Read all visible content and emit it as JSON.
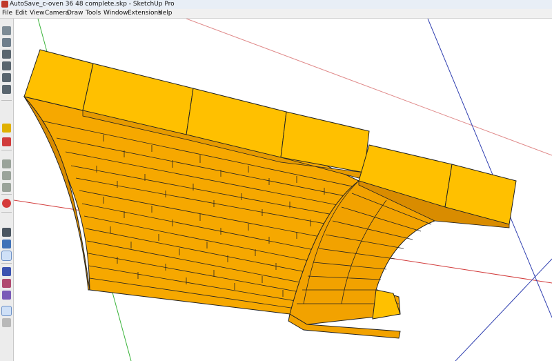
{
  "window": {
    "title": "AutoSave_c-oven 36 48 complete.skp - SketchUp Pro"
  },
  "menu": [
    "File",
    "Edit",
    "View",
    "Camera",
    "Draw",
    "Tools",
    "Window",
    "Extensions",
    "Help"
  ],
  "toolbar": {
    "icons": [
      "iso-view-icon",
      "top-view-icon",
      "front-view-icon",
      "right-view-icon",
      "back-view-icon",
      "left-view-icon",
      "tape-measure-icon",
      "paint-bucket-icon",
      "component-icon",
      "group-icon",
      "section-plane-icon",
      "orbit-icon",
      "pan-icon",
      "zoom-icon",
      "axes-icon",
      "style-icon",
      "shadow-icon",
      "layer-icon",
      "scenes-icon"
    ]
  },
  "colors": {
    "brick_face": "#ffc000",
    "brick_shade": "#f2a200",
    "brick_dark": "#d98c00",
    "axis_red": "#d23c3c",
    "axis_green": "#39b339",
    "axis_blue": "#2f3fb0"
  }
}
